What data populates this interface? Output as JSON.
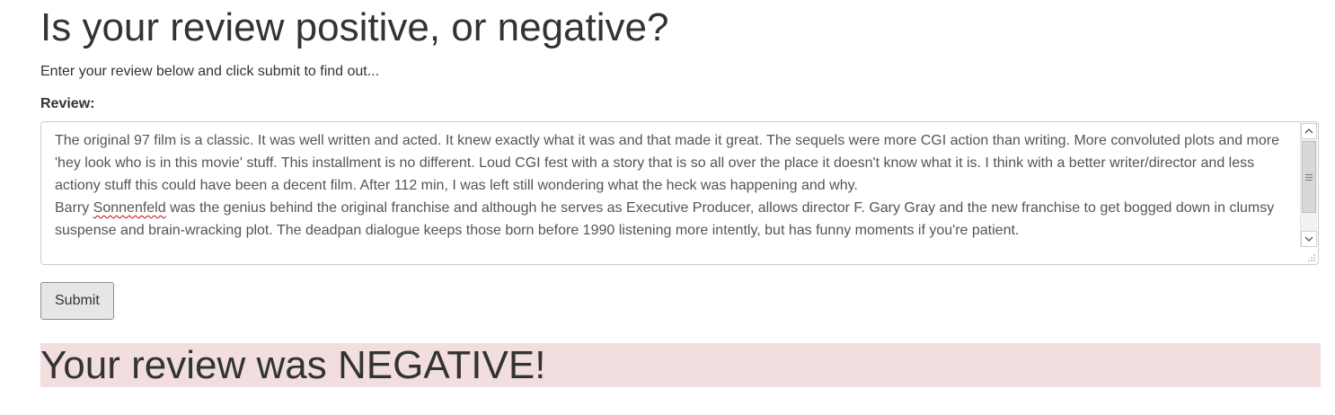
{
  "header": {
    "title": "Is your review positive, or negative?",
    "instruction": "Enter your review below and click submit to find out..."
  },
  "form": {
    "review_label": "Review:",
    "review_text_part1": "The original 97 film is a classic. It was well written and acted. It knew exactly what it was and that made it great. The sequels were more CGI action than writing. More convoluted plots and more 'hey look who is in this movie' stuff. This installment is no different. Loud CGI fest with a story that is so all over the place it doesn't know what it is. I think with a better writer/director and less actiony stuff this could have been a decent film. After 112 min, I was left still wondering what the heck was happening and why.\nBarry ",
    "review_text_misspelled": "Sonnenfeld",
    "review_text_part2": " was the genius behind the original franchise and although he serves as Executive Producer, allows director F. Gary Gray and the new franchise to get bogged down in clumsy suspense and brain-wracking plot. The deadpan dialogue keeps those born before 1990 listening more intently, but has funny moments if you're patient.",
    "submit_label": "Submit"
  },
  "result": {
    "text": "Your review was NEGATIVE!",
    "background_color": "#f2dede"
  },
  "icons": {
    "scroll_up": "chevron-up-icon",
    "scroll_down": "chevron-down-icon",
    "resize": "resize-grip-icon"
  }
}
